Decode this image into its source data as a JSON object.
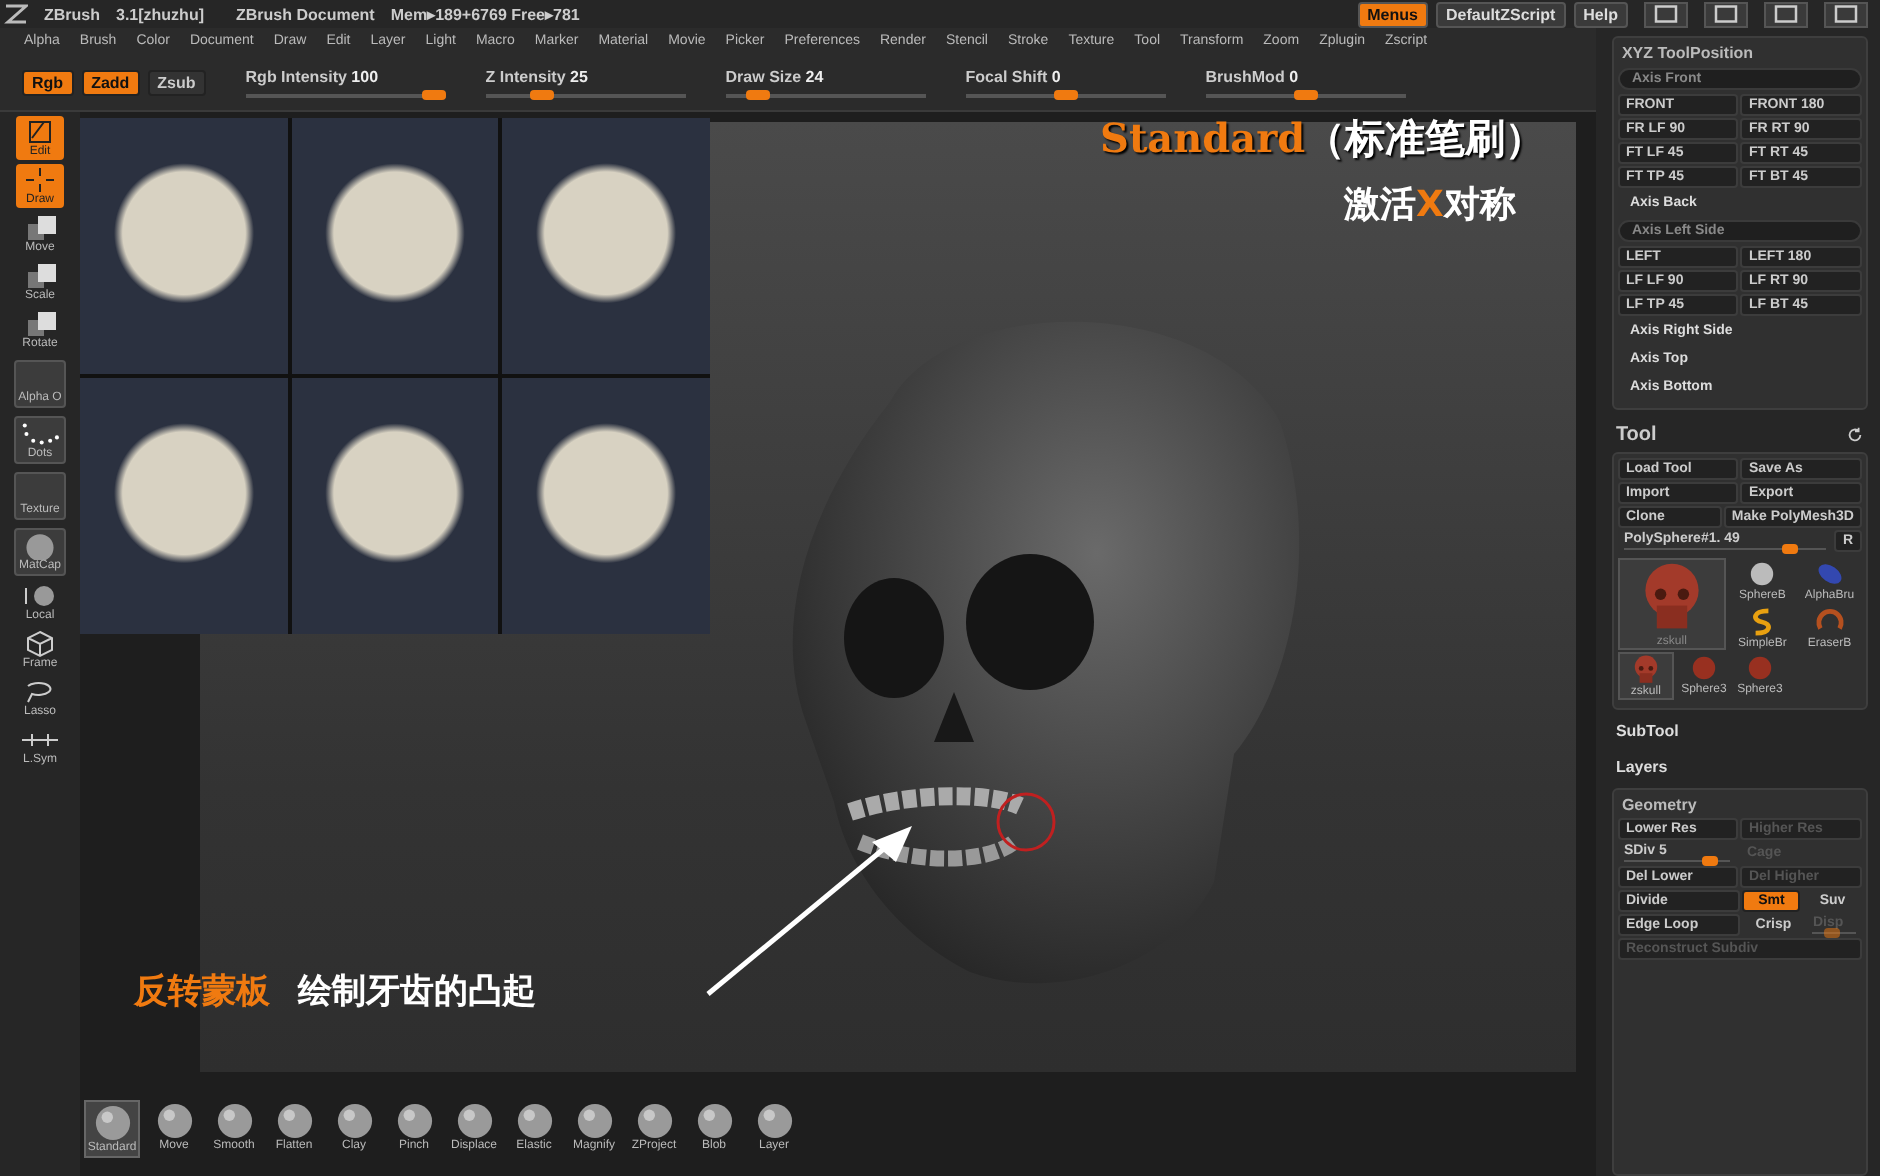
{
  "header": {
    "app": "ZBrush",
    "version": "3.1[zhuzhu]",
    "document": "ZBrush Document",
    "memory": "Mem▸189+6769 Free▸781",
    "buttons": [
      {
        "label": "Menus",
        "selected": true
      },
      {
        "label": "DefaultZScript",
        "selected": false
      },
      {
        "label": "Help",
        "selected": false
      }
    ]
  },
  "menus": [
    "Alpha",
    "Brush",
    "Color",
    "Document",
    "Draw",
    "Edit",
    "Layer",
    "Light",
    "Macro",
    "Marker",
    "Material",
    "Movie",
    "Picker",
    "Preferences",
    "Render",
    "Stencil",
    "Stroke",
    "Texture",
    "Tool",
    "Transform",
    "Zoom",
    "Zplugin",
    "Zscript"
  ],
  "draw_bar": {
    "toggles": [
      {
        "label": "Rgb",
        "on": true
      },
      {
        "label": "Zadd",
        "on": true
      },
      {
        "label": "Zsub",
        "on": false
      }
    ],
    "sliders": [
      {
        "label": "Rgb Intensity",
        "value": "100",
        "level": 1
      },
      {
        "label": "Z Intensity",
        "value": "25",
        "level": 0.25
      },
      {
        "label": "Draw Size",
        "value": "24",
        "level": 0.12
      },
      {
        "label": "Focal Shift",
        "value": "0",
        "level": 0.5
      },
      {
        "label": "BrushMod",
        "value": "0",
        "level": 0.5
      }
    ]
  },
  "left_tools": [
    {
      "kind": "button",
      "label": "Edit",
      "selected": true
    },
    {
      "kind": "button",
      "label": "Draw",
      "selected": true
    },
    {
      "kind": "button",
      "label": "Move",
      "selected": false
    },
    {
      "kind": "button",
      "label": "Scale",
      "selected": false
    },
    {
      "kind": "button",
      "label": "Rotate",
      "selected": false
    },
    {
      "kind": "swatch",
      "label": "Alpha  O",
      "selected": false
    },
    {
      "kind": "swatch",
      "label": "Dots",
      "selected": false
    },
    {
      "kind": "swatch",
      "label": "Texture",
      "selected": false
    },
    {
      "kind": "swatch",
      "label": "MatCap",
      "selected": false
    },
    {
      "kind": "button",
      "label": "Local",
      "selected": false
    },
    {
      "kind": "button",
      "label": "Frame",
      "selected": false
    },
    {
      "kind": "button",
      "label": "Lasso",
      "selected": false
    },
    {
      "kind": "button",
      "label": "L.Sym",
      "selected": false
    }
  ],
  "annotations": {
    "brush": {
      "name": "Standard",
      "note": "（标准笔刷）"
    },
    "symmetry": [
      {
        "text": "激活",
        "accent": false
      },
      {
        "text": "X",
        "accent": true
      },
      {
        "text": "对称",
        "accent": false
      }
    ],
    "mask": {
      "action": "反转蒙板",
      "note": "绘制牙齿的凸起"
    }
  },
  "brushes": [
    {
      "label": "Standard",
      "selected": true
    },
    {
      "label": "Move",
      "selected": false
    },
    {
      "label": "Smooth",
      "selected": false
    },
    {
      "label": "Flatten",
      "selected": false
    },
    {
      "label": "Clay",
      "selected": false
    },
    {
      "label": "Pinch",
      "selected": false
    },
    {
      "label": "Displace",
      "selected": false
    },
    {
      "label": "Elastic",
      "selected": false
    },
    {
      "label": "Magnify",
      "selected": false
    },
    {
      "label": "ZProject",
      "selected": false
    },
    {
      "label": "Blob",
      "selected": false
    },
    {
      "label": "Layer",
      "selected": false
    }
  ],
  "xyz_panel": {
    "title": "XYZ ToolPosition",
    "items": [
      {
        "kind": "pill",
        "label": "Axis Front"
      },
      {
        "kind": "pair",
        "buttons": [
          "FRONT",
          "FRONT 180"
        ]
      },
      {
        "kind": "pair",
        "buttons": [
          "FR LF 90",
          "FR RT 90"
        ]
      },
      {
        "kind": "pair",
        "buttons": [
          "FT LF 45",
          "FT RT 45"
        ]
      },
      {
        "kind": "pair",
        "buttons": [
          "FT TP 45",
          "FT BT 45"
        ]
      },
      {
        "kind": "label",
        "label": "Axis Back"
      },
      {
        "kind": "pill",
        "label": "Axis Left Side"
      },
      {
        "kind": "pair",
        "buttons": [
          "LEFT",
          "LEFT 180"
        ]
      },
      {
        "kind": "pair",
        "buttons": [
          "LF LF 90",
          "LF RT 90"
        ]
      },
      {
        "kind": "pair",
        "buttons": [
          "LF TP 45",
          "LF BT 45"
        ]
      },
      {
        "kind": "label",
        "label": "Axis Right Side"
      },
      {
        "kind": "label",
        "label": "Axis Top"
      },
      {
        "kind": "label",
        "label": "Axis Bottom"
      }
    ]
  },
  "tool_panel": {
    "title": "Tool",
    "rows": [
      [
        {
          "kind": "button",
          "label": "Load Tool",
          "disabled": false
        },
        {
          "kind": "button",
          "label": "Save As",
          "disabled": false
        }
      ],
      [
        {
          "kind": "button",
          "label": "Import",
          "disabled": false
        },
        {
          "kind": "button",
          "label": "Export",
          "disabled": false
        }
      ],
      [
        {
          "kind": "button",
          "label": "Clone",
          "disabled": false
        },
        {
          "kind": "button",
          "label": "Make PolyMesh3D",
          "disabled": false
        }
      ],
      [
        {
          "kind": "slider",
          "label": "PolySphere#1. 49",
          "level": 0.85,
          "disabled": false
        },
        {
          "kind": "button",
          "label": "R",
          "disabled": false
        }
      ]
    ],
    "current_tool": {
      "label": "zskull",
      "kind": "skull"
    },
    "quick_tools": [
      {
        "label": "SphereB",
        "kind": "sphere"
      },
      {
        "label": "AlphaBru",
        "kind": "capsule"
      },
      {
        "label": "SimpleBr",
        "kind": "swirl"
      },
      {
        "label": "EraserB",
        "kind": "ring"
      }
    ],
    "recent_tools": [
      {
        "label": "zskull",
        "kind": "skull"
      },
      {
        "label": "Sphere3",
        "kind": "ball"
      },
      {
        "label": "Sphere3",
        "kind": "ball"
      }
    ]
  },
  "sections": [
    "SubTool",
    "Layers"
  ],
  "geometry": {
    "title": "Geometry",
    "rows": [
      [
        {
          "kind": "button",
          "label": "Lower Res",
          "disabled": false
        },
        {
          "kind": "button",
          "label": "Higher Res",
          "disabled": true
        }
      ],
      [
        {
          "kind": "slider",
          "label": "SDiv 5",
          "level": 0.85,
          "disabled": false
        },
        {
          "kind": "text",
          "label": "Cage",
          "disabled": true
        }
      ],
      [
        {
          "kind": "button",
          "label": "Del Lower",
          "disabled": false
        },
        {
          "kind": "button",
          "label": "Del Higher",
          "disabled": true
        }
      ],
      [
        {
          "kind": "button",
          "label": "Divide",
          "disabled": false
        },
        {
          "kind": "toggle",
          "label": "Smt",
          "on": true,
          "disabled": false
        },
        {
          "kind": "toggle",
          "label": "Suv",
          "on": false,
          "disabled": false
        }
      ],
      [
        {
          "kind": "button",
          "label": "Edge Loop",
          "disabled": false
        },
        {
          "kind": "toggle",
          "label": "Crisp",
          "on": false,
          "disabled": false
        },
        {
          "kind": "slider",
          "label": "Disp",
          "level": 0.4,
          "disabled": true
        }
      ],
      [
        {
          "kind": "button",
          "label": "Reconstruct Subdiv",
          "disabled": true
        }
      ]
    ]
  }
}
